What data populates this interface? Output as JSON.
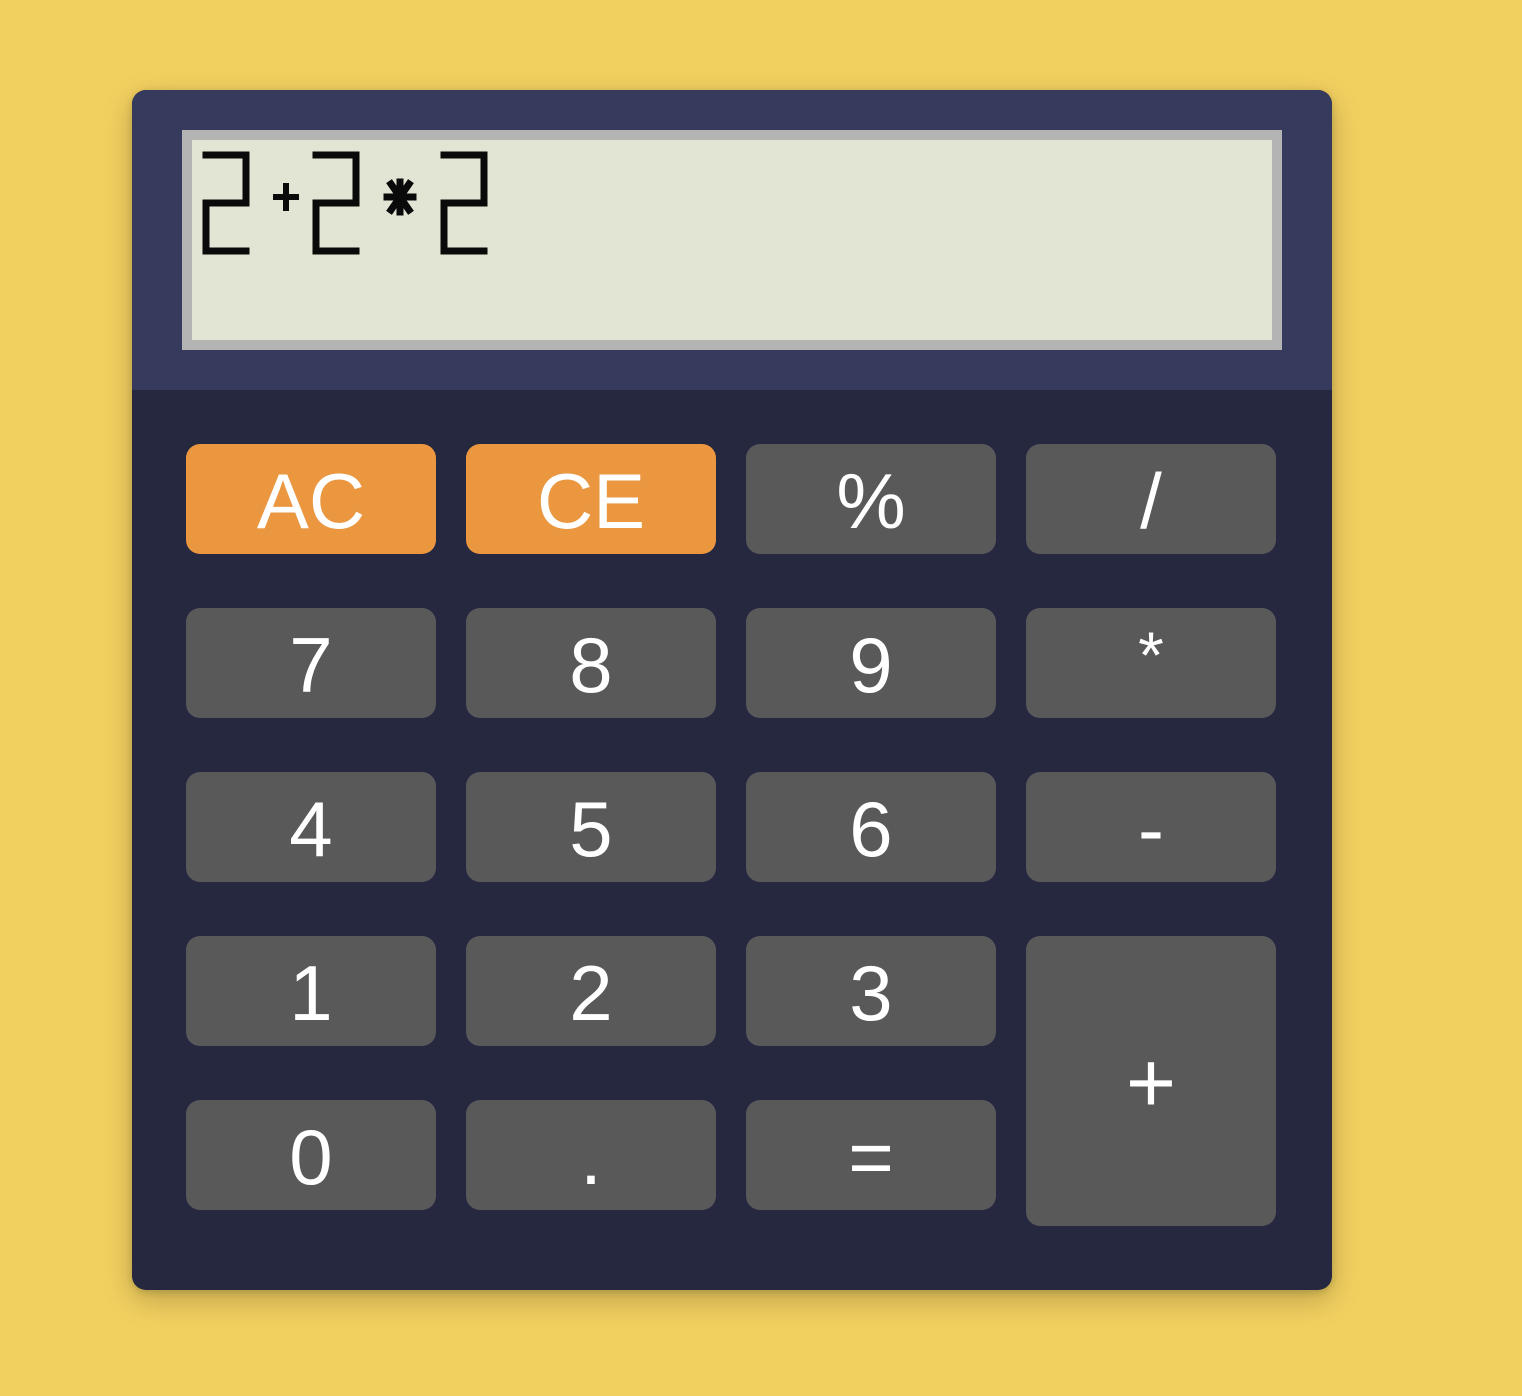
{
  "display": {
    "expression": "2+2*2"
  },
  "colors": {
    "background": "#f2d060",
    "body": "#262840",
    "display_panel": "#363a5c",
    "screen": "#e2e4d4",
    "screen_border": "#b4b4b4",
    "key": "#595959",
    "key_accent": "#ea9740",
    "key_text": "#ffffff",
    "lcd_segment": "#0a0a0a"
  },
  "keys": {
    "ac": "AC",
    "ce": "CE",
    "percent": "%",
    "divide": "/",
    "seven": "7",
    "eight": "8",
    "nine": "9",
    "multiply": "*",
    "four": "4",
    "five": "5",
    "six": "6",
    "minus": "-",
    "one": "1",
    "two": "2",
    "three": "3",
    "plus": "+",
    "zero": "0",
    "dot": ".",
    "equals": "="
  }
}
